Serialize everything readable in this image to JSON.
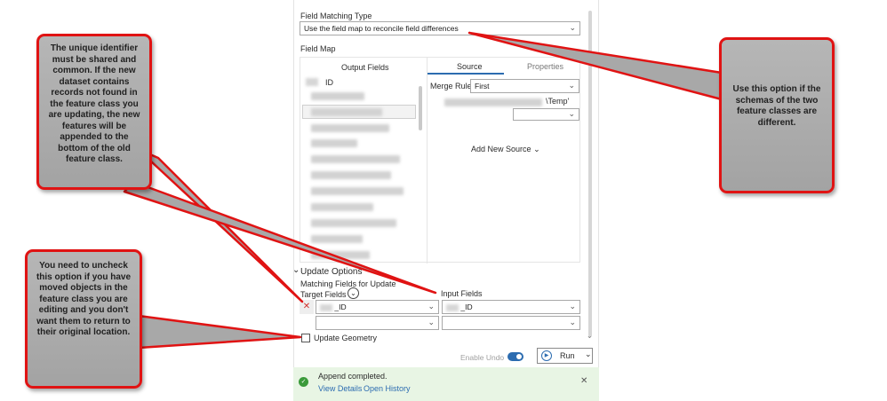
{
  "tool": {
    "field_matching_type_label": "Field Matching Type",
    "field_matching_value": "Use the field map to reconcile field differences",
    "field_map_label": "Field Map",
    "output_fields_header": "Output Fields",
    "source_tab": "Source",
    "properties_tab": "Properties",
    "output_fields": [
      "ID"
    ],
    "merge_rule_label": "Merge Rule",
    "merge_rule_value": "First",
    "source_path": "\\Temp'",
    "add_new_source": "Add New Source"
  },
  "update_options": {
    "section_title": "Update Options",
    "matching_fields_label": "Matching Fields for Update",
    "target_fields_label": "Target Fields",
    "input_fields_label": "Input Fields",
    "target_value": "_ID",
    "input_value": "_ID",
    "update_geometry_label": "Update Geometry",
    "update_geometry_checked": false
  },
  "footer": {
    "enable_undo_label": "Enable Undo",
    "enable_undo_on": true,
    "run_label": "Run"
  },
  "toast": {
    "message": "Append completed.",
    "view_details": "View Details",
    "open_history": "Open History"
  },
  "callouts": {
    "left_top": "The unique identifier must be shared and common. If the new dataset contains records not found in the feature class you are updating, the new features will be appended to the bottom of the old feature class.",
    "left_bottom": "You need to uncheck this option if you have moved objects in the feature class you are editing and you don't want them to return to their original location.",
    "right": "Use this option if the schemas of the two feature classes are different."
  },
  "colors": {
    "callout_border": "#e01313",
    "callout_fill": "#a9a9a9",
    "toast_bg": "#e8f5e4",
    "toggle_on": "#2c6cb0",
    "link": "#2c6cb0"
  }
}
